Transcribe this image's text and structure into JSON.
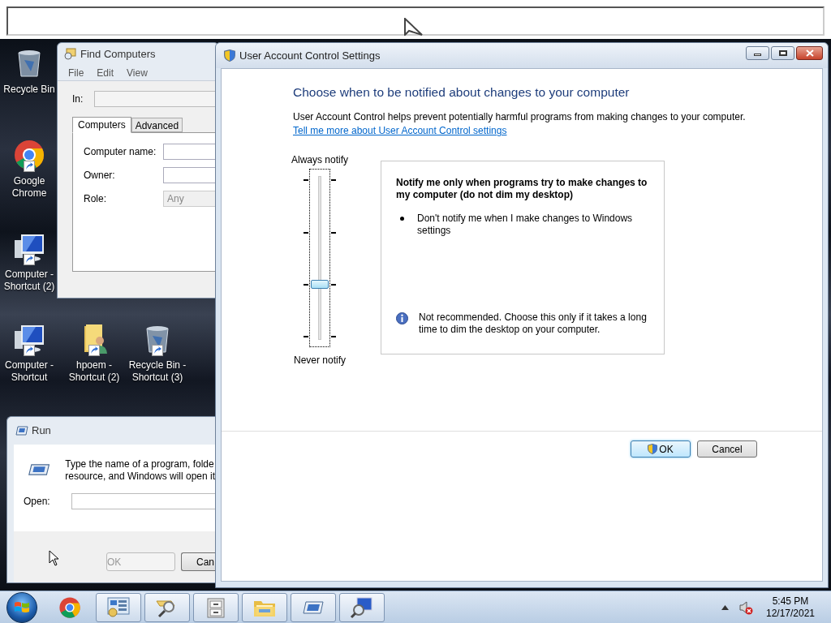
{
  "desktop_icons": [
    {
      "label": "Recycle Bin",
      "kind": "recycle-bin",
      "shortcut": false
    },
    {
      "label": "Google Chrome",
      "kind": "chrome",
      "shortcut": true
    },
    {
      "label": "Computer - Shortcut (2)",
      "kind": "computer",
      "shortcut": true
    },
    {
      "label": "Computer - Shortcut",
      "kind": "computer",
      "shortcut": true
    },
    {
      "label": "hpoem - Shortcut (2)",
      "kind": "user-folder",
      "shortcut": true
    },
    {
      "label": "Recycle Bin - Shortcut (3)",
      "kind": "recycle-bin",
      "shortcut": true
    }
  ],
  "find_window": {
    "title": "Find Computers",
    "menu": [
      "File",
      "Edit",
      "View"
    ],
    "in_label": "In:",
    "tabs": [
      {
        "label": "Computers",
        "selected": true
      },
      {
        "label": "Advanced",
        "selected": false
      }
    ],
    "fields": [
      {
        "label": "Computer name:",
        "disabled": false
      },
      {
        "label": "Owner:",
        "disabled": false
      },
      {
        "label": "Role:",
        "value": "Any",
        "disabled": true
      }
    ]
  },
  "run_window": {
    "title": "Run",
    "lines": [
      "Type the name of a program, folde",
      "resource, and Windows will open it"
    ],
    "open_label": "Open:",
    "buttons": [
      {
        "label": "OK",
        "disabled": true
      },
      {
        "label": "Can",
        "disabled": false
      }
    ]
  },
  "uac_window": {
    "title": "User Account Control Settings",
    "heading": "Choose when to be notified about changes to your computer",
    "description": "User Account Control helps prevent potentially harmful programs from making changes to your computer.",
    "link": "Tell me more about User Account Control settings",
    "slider": {
      "top_label": "Always notify",
      "bottom_label": "Never notify",
      "level": 0.333
    },
    "panel": {
      "title": "Notify me only when programs try to make changes to my computer (do not dim my desktop)",
      "bullets": [
        "Don't notify me when I make changes to Windows settings"
      ],
      "note": "Not recommended. Choose this only if it takes a long time to dim the desktop on your computer."
    },
    "buttons": [
      {
        "label": "OK",
        "default": true
      },
      {
        "label": "Cancel",
        "default": false
      }
    ]
  },
  "taskbar": {
    "items": [
      {
        "kind": "chrome",
        "open": false
      },
      {
        "kind": "control-panel",
        "open": true
      },
      {
        "kind": "search",
        "open": true
      },
      {
        "kind": "file-cabinet",
        "open": true
      },
      {
        "kind": "folder",
        "open": true
      },
      {
        "kind": "run",
        "open": true
      },
      {
        "kind": "find-computer",
        "open": true
      }
    ],
    "tray": {
      "muted": true,
      "time": "5:45 PM",
      "date": "12/17/2021"
    }
  }
}
